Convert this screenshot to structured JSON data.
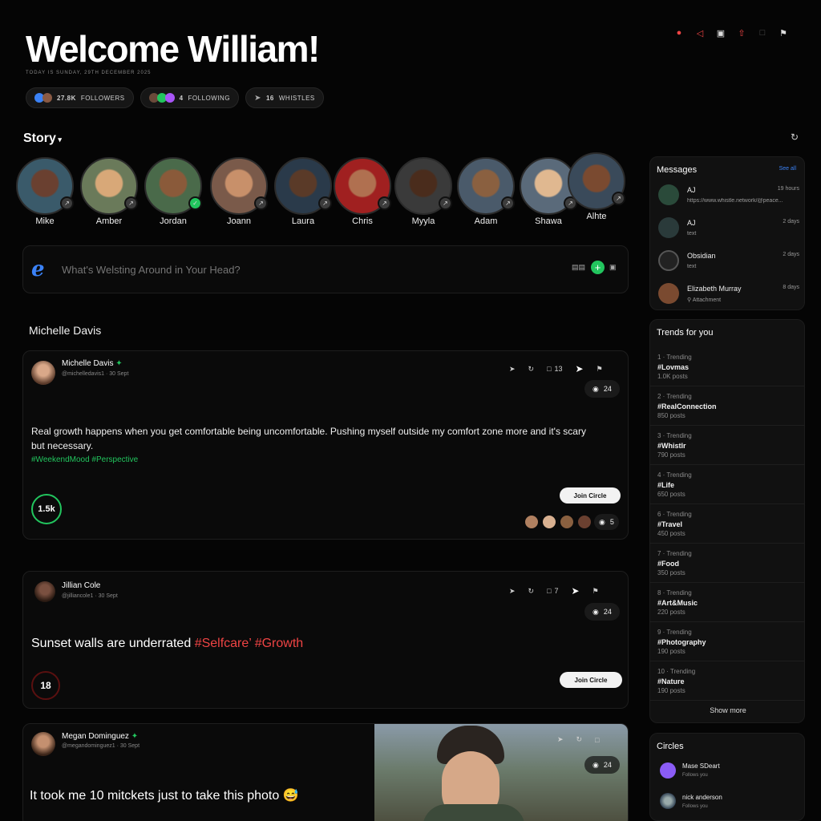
{
  "header": {
    "title": "Welcome William!",
    "date": "TODAY IS SUNDAY, 29TH DECEMBER 2025",
    "stats": [
      {
        "value": "27.8K",
        "label": "FOLLOWERS"
      },
      {
        "value": "4",
        "label": "FOLLOWING"
      },
      {
        "value": "16",
        "label": "WHISTLES"
      }
    ]
  },
  "top_icons": [
    "notification-icon",
    "send-icon",
    "bag-icon",
    "upload-icon",
    "image-icon",
    "bookmark-icon"
  ],
  "story": {
    "title": "Story",
    "people": [
      "Mike",
      "Amber",
      "Jordan",
      "Joann",
      "Laura",
      "Chris",
      "Myyla",
      "Adam",
      "Shawa",
      "Alhte"
    ]
  },
  "composer": {
    "placeholder": "What's Welsting Around in Your Head?"
  },
  "feed_section": "Michelle Davis",
  "posts": [
    {
      "author": "Michelle Davis",
      "handle": "@michelledavis1",
      "date": "30 Sept",
      "comments": "13",
      "views": "24",
      "text": "Real growth happens when you get comfortable being uncomfortable. Pushing myself outside my comfort zone more and it's scary but necessary.",
      "tags": "#WeekendMood #Perspective",
      "score": "1.5k",
      "cta": "Join Circle",
      "watchers": "5"
    },
    {
      "author": "Jillian Cole",
      "handle": "@jilliancole1",
      "date": "30 Sept",
      "comments": "7",
      "views": "24",
      "text": "Sunset walls are underrated",
      "tags": "#Selfcare’ #Growth",
      "score": "18",
      "cta": "Join Circle"
    },
    {
      "author": "Megan Dominguez",
      "handle": "@megandominguez1",
      "date": "30 Sept",
      "views": "24",
      "text": "It took me 10 mitckets just to take this photo 😅"
    }
  ],
  "messages": {
    "title": "Messages",
    "see_all": "See all",
    "items": [
      {
        "name": "AJ",
        "text": "https://www.whistle.network/@peace...",
        "time": "19 hours"
      },
      {
        "name": "AJ",
        "text": "text",
        "time": "2 days"
      },
      {
        "name": "Obsidian",
        "text": "text",
        "time": "2 days"
      },
      {
        "name": "Elizabeth Murray",
        "text": "Attachment",
        "time": "8 days"
      }
    ]
  },
  "trends": {
    "title": "Trends for you",
    "items": [
      {
        "rank": "1 · Trending",
        "tag": "#Lovmas",
        "posts": "1.0K posts"
      },
      {
        "rank": "2 · Trending",
        "tag": "#RealConnection",
        "posts": "850 posts"
      },
      {
        "rank": "3 · Trending",
        "tag": "#Whistlr",
        "posts": "790 posts"
      },
      {
        "rank": "4 · Trending",
        "tag": "#Life",
        "posts": "650 posts"
      },
      {
        "rank": "6 · Trending",
        "tag": "#Travel",
        "posts": "450 posts"
      },
      {
        "rank": "7 · Trending",
        "tag": "#Food",
        "posts": "350 posts"
      },
      {
        "rank": "8 · Trending",
        "tag": "#Art&Music",
        "posts": "220 posts"
      },
      {
        "rank": "9 · Trending",
        "tag": "#Photography",
        "posts": "190 posts"
      },
      {
        "rank": "10 · Trending",
        "tag": "#Nature",
        "posts": "190 posts"
      }
    ],
    "show_more": "Show more"
  },
  "circles": {
    "title": "Circles",
    "items": [
      {
        "name": "Mase SDeart",
        "sub": "Follows you"
      },
      {
        "name": "nick anderson",
        "sub": "Follows you"
      }
    ]
  },
  "colors": {
    "accent_green": "#22c55e",
    "accent_red": "#ef4444",
    "accent_blue": "#3b82f6"
  }
}
